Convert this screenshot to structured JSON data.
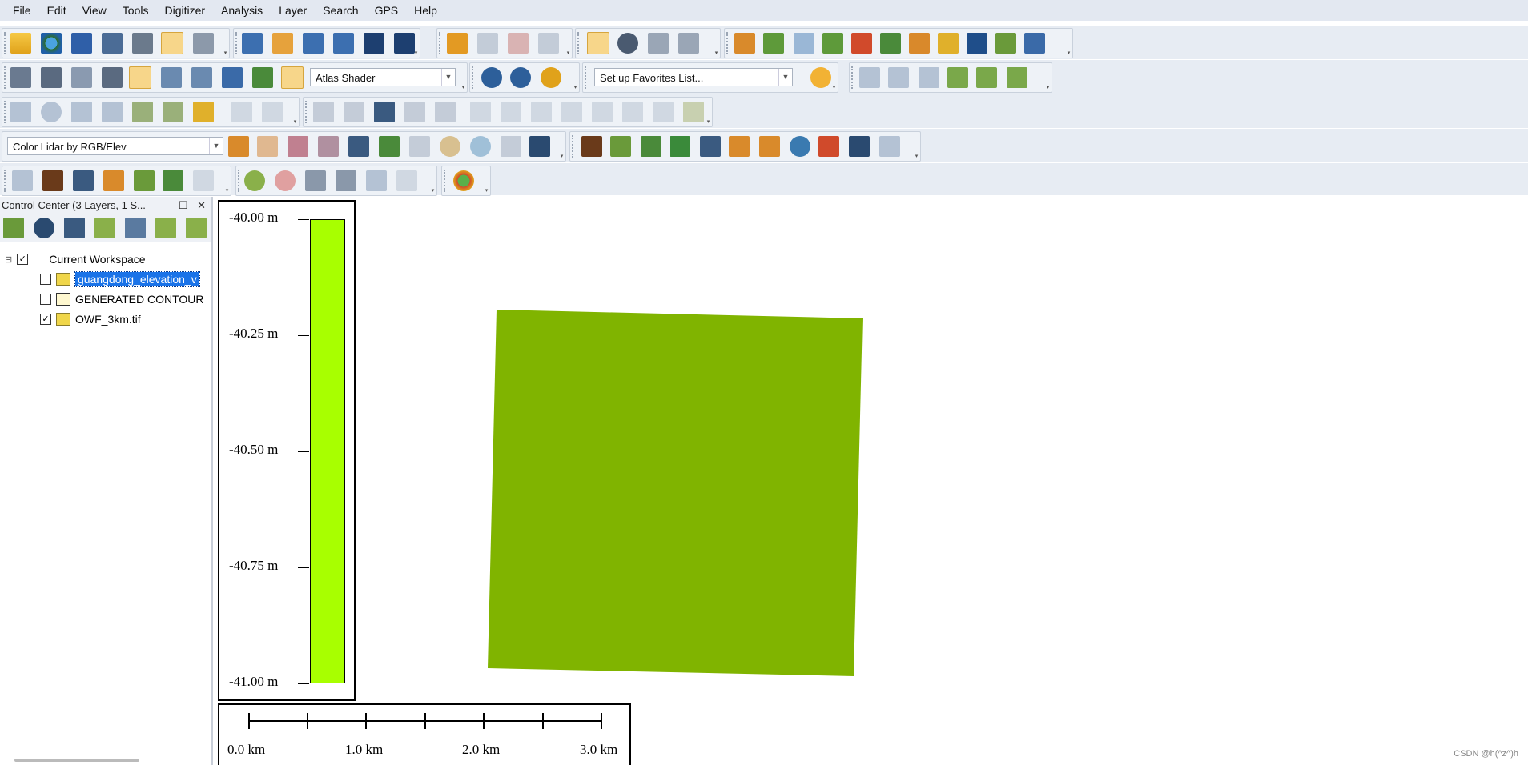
{
  "menu": [
    "File",
    "Edit",
    "View",
    "Tools",
    "Digitizer",
    "Analysis",
    "Layer",
    "Search",
    "GPS",
    "Help"
  ],
  "toolbar": {
    "shader_combo": "Atlas Shader",
    "favorites_combo": "Set up Favorites List...",
    "lidar_combo": "Color Lidar by RGB/Elev"
  },
  "control_center": {
    "title": "Control Center (3 Layers, 1 S...",
    "workspace_label": "Current Workspace",
    "layers": [
      {
        "name": "guangdong_elevation_v",
        "checked": false,
        "selected": true
      },
      {
        "name": "GENERATED CONTOUR",
        "checked": false,
        "selected": false
      },
      {
        "name": "OWF_3km.tif",
        "checked": true,
        "selected": false
      }
    ]
  },
  "legend": {
    "labels": [
      "-40.00 m",
      "-40.25 m",
      "-40.50 m",
      "-40.75 m",
      "-41.00 m"
    ],
    "color": "#a8ff00"
  },
  "scale_bar": {
    "labels": [
      "0.0 km",
      "1.0 km",
      "2.0 km",
      "3.0 km"
    ]
  },
  "raster": {
    "color": "#80b400"
  },
  "watermark": "CSDN @h(^z^)h"
}
